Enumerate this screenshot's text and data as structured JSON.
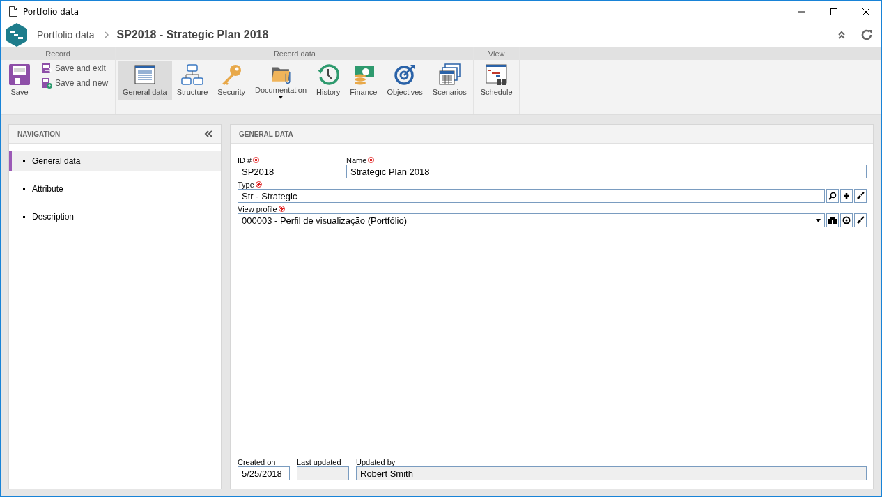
{
  "window": {
    "title": "Portfolio data"
  },
  "header": {
    "breadcrumb": "Portfolio data",
    "title": "SP2018 - Strategic Plan 2018"
  },
  "ribbon": {
    "groups": [
      {
        "label": "Record",
        "items": [
          {
            "label": "Save",
            "kind": "large",
            "selected": false
          },
          {
            "label": "Save and exit",
            "kind": "small",
            "selected": false
          },
          {
            "label": "Save and new",
            "kind": "small",
            "selected": false
          }
        ]
      },
      {
        "label": "Record data",
        "items": [
          {
            "label": "General data",
            "kind": "large",
            "selected": true
          },
          {
            "label": "Structure",
            "kind": "large",
            "selected": false
          },
          {
            "label": "Security",
            "kind": "large",
            "selected": false
          },
          {
            "label": "Documentation",
            "kind": "dropdown",
            "selected": false
          },
          {
            "label": "History",
            "kind": "large",
            "selected": false
          },
          {
            "label": "Finance",
            "kind": "large",
            "selected": false
          },
          {
            "label": "Objectives",
            "kind": "large",
            "selected": false
          },
          {
            "label": "Scenarios",
            "kind": "large",
            "selected": false
          }
        ]
      },
      {
        "label": "View",
        "items": [
          {
            "label": "Schedule",
            "kind": "large",
            "selected": false
          }
        ]
      }
    ]
  },
  "navigation": {
    "title": "NAVIGATION",
    "items": [
      {
        "label": "General data",
        "selected": true
      },
      {
        "label": "Attribute",
        "selected": false
      },
      {
        "label": "Description",
        "selected": false
      }
    ]
  },
  "general_data": {
    "title": "GENERAL DATA",
    "rows": [
      [
        {
          "label": "ID #",
          "value": "SP2018",
          "required": true,
          "kind": "text"
        },
        {
          "label": "Name",
          "value": "Strategic Plan 2018",
          "required": true,
          "kind": "text"
        }
      ],
      [
        {
          "label": "Type",
          "value": "Str - Strategic",
          "required": true,
          "kind": "lookup"
        }
      ],
      [
        {
          "label": "View profile",
          "value": "000003 - Perfil de visualização (Portfólio)",
          "required": true,
          "kind": "select"
        }
      ]
    ],
    "footer": [
      {
        "label": "Created on",
        "value": "5/25/2018",
        "disabled": false
      },
      {
        "label": "Last updated",
        "disabled": true
      },
      {
        "label": "Updated by",
        "value": "Robert Smith",
        "disabled": true
      }
    ]
  }
}
